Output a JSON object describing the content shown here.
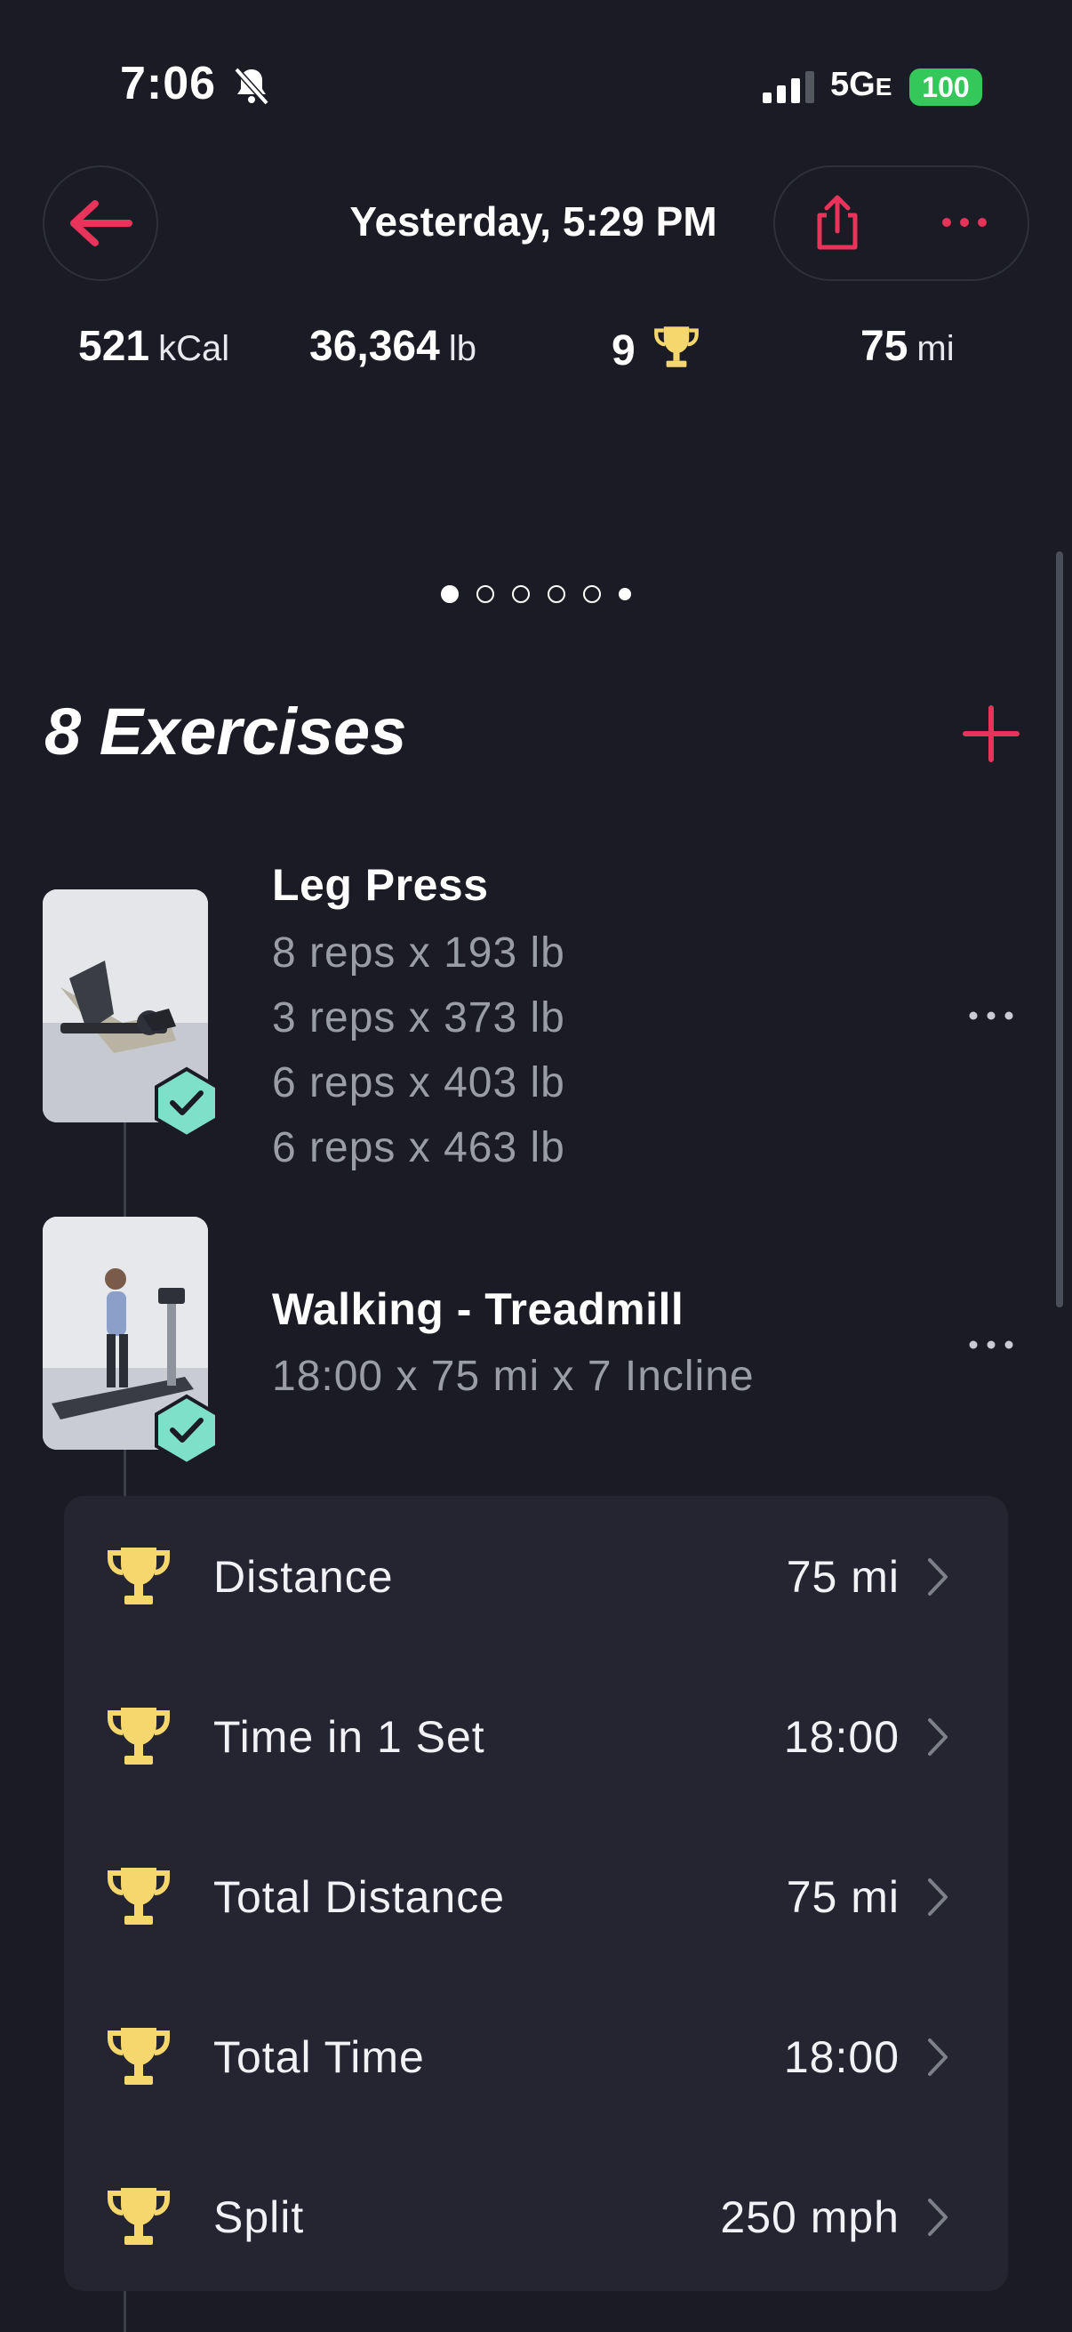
{
  "status_bar": {
    "time": "7:06",
    "network": "5G",
    "network_suffix": "E",
    "battery": "100"
  },
  "header": {
    "title": "Yesterday, 5:29 PM"
  },
  "stats": {
    "calories": {
      "value": "521",
      "unit": "kCal"
    },
    "volume": {
      "value": "36,364",
      "unit": "lb"
    },
    "records": {
      "value": "9"
    },
    "distance": {
      "value": "75",
      "unit": "mi"
    }
  },
  "pager": {
    "pages": 6,
    "active_index": 0
  },
  "exercises_section": {
    "title": "8 Exercises"
  },
  "exercises": [
    {
      "name": "Leg Press",
      "sets": [
        "8 reps x 193 lb",
        "3 reps x 373 lb",
        "6 reps x 403 lb",
        "6 reps x 463 lb"
      ],
      "completed": true
    },
    {
      "name": "Walking - Treadmill",
      "sets": [
        "18:00 x 75 mi x 7 Incline"
      ],
      "completed": true
    }
  ],
  "records": [
    {
      "label": "Distance",
      "value": "75 mi"
    },
    {
      "label": "Time in 1 Set",
      "value": "18:00"
    },
    {
      "label": "Total Distance",
      "value": "75 mi"
    },
    {
      "label": "Total Time",
      "value": "18:00"
    },
    {
      "label": "Split",
      "value": "250 mph"
    }
  ],
  "colors": {
    "background": "#1a1b24",
    "accent": "#e8345a",
    "trophy": "#f5d76e",
    "check_badge": "#7fe0c9",
    "card": "#242531"
  }
}
